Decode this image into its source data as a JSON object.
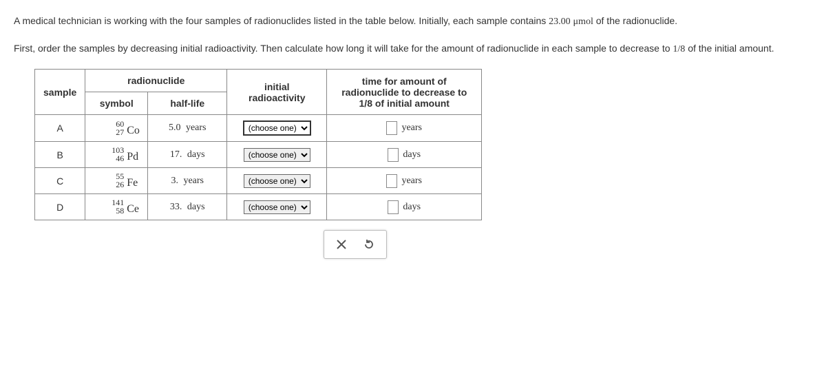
{
  "intro": {
    "p1_before_amount": "A medical technician is working with the four samples of radionuclides listed in the table below. Initially, each sample contains ",
    "amount": "23.00",
    "unit": "μmol",
    "p1_after_amount": " of the radionuclide.",
    "p2_a": "First, order the samples by decreasing initial radioactivity. Then calculate how long it will take for the amount of radionuclide in each sample to decrease to ",
    "frac": "1/8",
    "p2_b": " of the initial amount."
  },
  "headers": {
    "sample": "sample",
    "radionuclide": "radionuclide",
    "symbol": "symbol",
    "half_life": "half-life",
    "initial": "initial radioactivity",
    "time_col_l1": "time for amount of",
    "time_col_l2": "radionuclide to decrease to",
    "time_col_l3": "1/8 of initial amount"
  },
  "rows": [
    {
      "id": "A",
      "mass": "60",
      "elem": "Co",
      "atomic": "27",
      "half_val": "5.0",
      "half_unit": "years",
      "time_unit": "years",
      "select_style": "outlined"
    },
    {
      "id": "B",
      "mass": "103",
      "elem": "Pd",
      "atomic": "46",
      "half_val": "17.",
      "half_unit": "days",
      "time_unit": "days",
      "select_style": ""
    },
    {
      "id": "C",
      "mass": "55",
      "elem": "Fe",
      "atomic": "26",
      "half_val": "3.",
      "half_unit": "years",
      "time_unit": "years",
      "select_style": ""
    },
    {
      "id": "D",
      "mass": "141",
      "elem": "Ce",
      "atomic": "58",
      "half_val": "33.",
      "half_unit": "days",
      "time_unit": "days",
      "select_style": ""
    }
  ],
  "choose_one": "(choose one)"
}
